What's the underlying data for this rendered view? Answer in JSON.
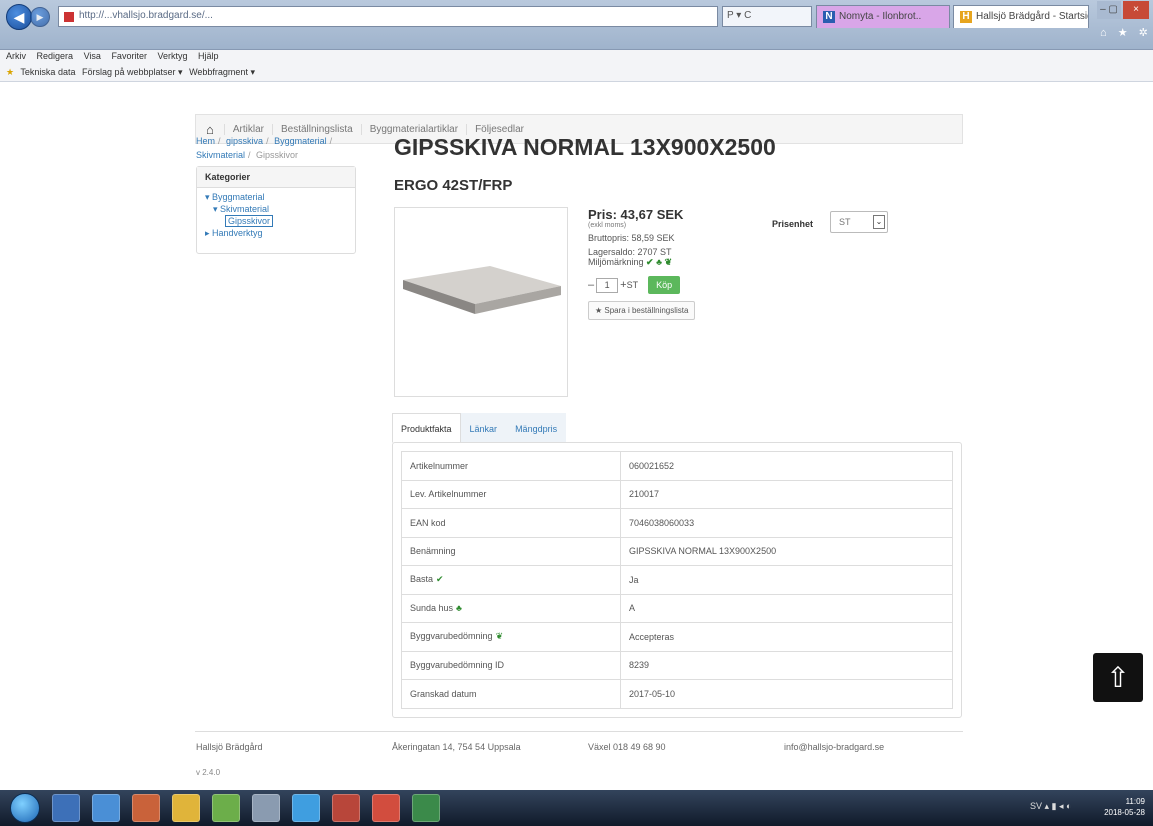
{
  "browser": {
    "address": "http://...vhallsjo.bradgard.se/...",
    "address_controls": "P ▾ C",
    "tabs": [
      {
        "icon": "N",
        "label": "Nomyta - Ilonbrot.."
      },
      {
        "icon": "H",
        "label": "Hallsjö Brädgård - Startsid..."
      }
    ],
    "window_close": "×",
    "window_minmax": "– ▢",
    "toolbar_icons": "⌂ ★ ✲",
    "menu": [
      "Arkiv",
      "Redigera",
      "Visa",
      "Favoriter",
      "Verktyg",
      "Hjälp"
    ],
    "favorites": [
      "Tekniska data",
      "Förslag på webbplatser ▾",
      "Webbfragment ▾"
    ]
  },
  "site_nav": {
    "home_icon": "home-icon",
    "links": [
      "Artiklar",
      "Beställningslista",
      "Byggmaterialartiklar",
      "Följesedlar"
    ]
  },
  "breadcrumb": {
    "items": [
      "Hem",
      "gipsskiva",
      "Byggmaterial",
      "Skivmaterial"
    ],
    "current": "Gipsskivor"
  },
  "categories": {
    "title": "Kategorier",
    "items": [
      {
        "level": 1,
        "label": "▾ Byggmaterial"
      },
      {
        "level": 2,
        "label": "▾ Skivmaterial"
      },
      {
        "level": 3,
        "label": "Gipsskivor"
      },
      {
        "level": 1,
        "label": "▸ Handverktyg"
      }
    ]
  },
  "product": {
    "title": "GIPSSKIVA NORMAL 13X900X2500",
    "subtitle": "ERGO 42ST/FRP",
    "price_label": "Pris:",
    "price_value": "43,67",
    "price_currency": "SEK",
    "price_note": "(exkl moms)",
    "gross_price": "Bruttopris: 58,59 SEK",
    "stock": "Lagersaldo: 2707 ST",
    "eco_label": "Miljömärkning",
    "eco_icons": "✔ ♣ ❦",
    "qty_minus": "–",
    "qty_value": "1",
    "qty_plus": "+",
    "qty_unit": "ST",
    "buy_label": "Köp",
    "order_list_label": "★ Spara i beställningslista",
    "unit_label": "Prisenhet",
    "unit_value": "ST",
    "unit_arrow": "⌄"
  },
  "tabs": [
    {
      "label": "Produktfakta",
      "active": true
    },
    {
      "label": "Länkar",
      "active": false
    },
    {
      "label": "Mängdpris",
      "active": false
    }
  ],
  "specs": [
    {
      "key": "Artikelnummer",
      "value": "060021652",
      "mark": ""
    },
    {
      "key": "Lev. Artikelnummer",
      "value": "210017",
      "mark": ""
    },
    {
      "key": "EAN kod",
      "value": "7046038060033",
      "mark": ""
    },
    {
      "key": "Benämning",
      "value": "GIPSSKIVA NORMAL 13X900X2500",
      "mark": ""
    },
    {
      "key": "Basta",
      "value": "Ja",
      "mark": "✔"
    },
    {
      "key": "Sunda hus",
      "value": "A",
      "mark": "♣"
    },
    {
      "key": "Byggvarubedömning",
      "value": "Accepteras",
      "mark": "❦"
    },
    {
      "key": "Byggvarubedömning ID",
      "value": "8239",
      "mark": ""
    },
    {
      "key": "Granskad datum",
      "value": "2017-05-10",
      "mark": ""
    }
  ],
  "footer": {
    "company": "Hallsjö Brädgård",
    "address": "Åkeringatan 14, 754 54 Uppsala",
    "phone": "Växel 018 49 68 90",
    "email": "info@hallsjo-bradgard.se",
    "version": "v 2.4.0"
  },
  "scroll_top_icon": "⇧",
  "taskbar": {
    "tray_icons": "SV ▴ ▮ ◂ ◐",
    "clock_time": "11:09",
    "clock_date": "2018-05-28"
  }
}
